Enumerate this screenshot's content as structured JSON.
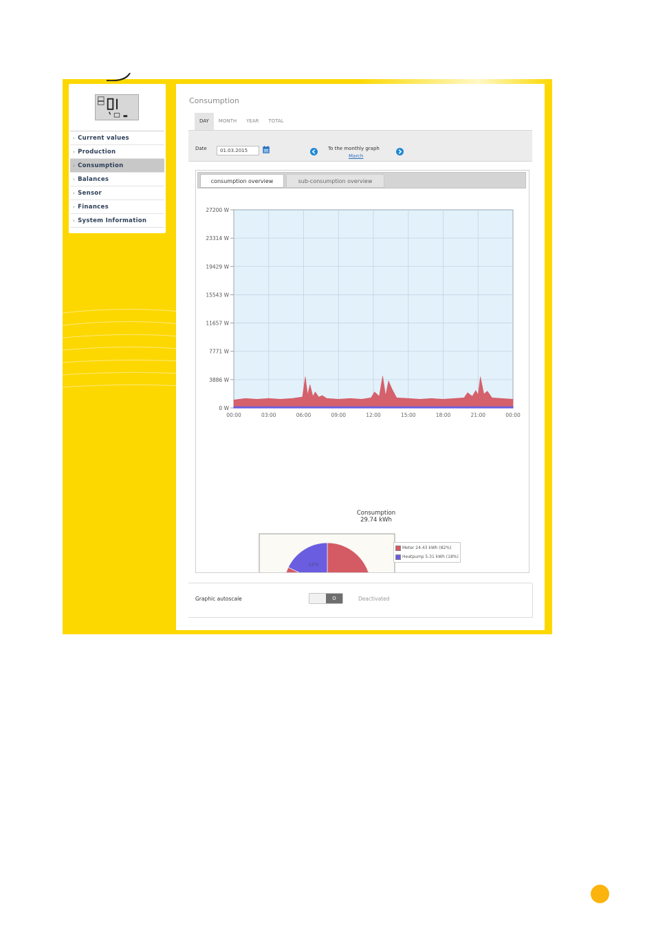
{
  "sidebar": {
    "items": [
      {
        "label": "Current values",
        "active": false
      },
      {
        "label": "Production",
        "active": false
      },
      {
        "label": "Consumption",
        "active": true
      },
      {
        "label": "Balances",
        "active": false
      },
      {
        "label": "Sensor",
        "active": false
      },
      {
        "label": "Finances",
        "active": false
      },
      {
        "label": "System Information",
        "active": false
      }
    ]
  },
  "panel": {
    "title": "Consumption",
    "tabs": [
      "DAY",
      "MONTH",
      "YEAR",
      "TOTAL"
    ],
    "active_tab": "DAY",
    "date_label": "Date",
    "date_value": "01.03.2015",
    "monthly_label": "To the monthly graph",
    "monthly_link": "March",
    "subtabs": [
      "consumption overview",
      "sub-consumption overview"
    ],
    "active_subtab": "consumption overview",
    "autoscale_label": "Graphic autoscale",
    "toggle_knob": "O",
    "toggle_status": "Deactivated"
  },
  "colors": {
    "frame_yellow": "#fcd800",
    "meter": "#d45a64",
    "heatpump": "#6a5de0",
    "plot_bg": "#e3f1fb",
    "page_dot": "#fbb40e"
  },
  "icons": [
    "calendar-icon",
    "arrow-left-icon",
    "arrow-right-icon"
  ],
  "chart_data": [
    {
      "type": "area",
      "title": "Consumption",
      "subtitle": "29.74 kWh",
      "x_ticks": [
        "00:00",
        "03:00",
        "06:00",
        "09:00",
        "12:00",
        "15:00",
        "18:00",
        "21:00",
        "00:00"
      ],
      "y_ticks": [
        "27200 W",
        "23314 W",
        "19429 W",
        "15543 W",
        "11657 W",
        "7771 W",
        "3886 W",
        "0 W"
      ],
      "ylim": [
        0,
        27200
      ],
      "grid": true,
      "series": [
        {
          "name": "Meter",
          "color": "#d45a64",
          "x_hours": [
            0,
            1,
            2,
            3,
            4,
            5,
            5.9,
            6.15,
            6.35,
            6.55,
            6.8,
            7,
            7.3,
            7.6,
            8,
            9,
            10,
            11,
            11.8,
            12.1,
            12.5,
            12.8,
            13.05,
            13.3,
            13.6,
            14,
            15,
            16,
            17,
            18,
            19,
            19.8,
            20.1,
            20.5,
            20.8,
            21,
            21.2,
            21.5,
            21.8,
            22.2,
            23,
            24
          ],
          "values": [
            1100,
            1300,
            1200,
            1300,
            1200,
            1300,
            1500,
            4300,
            1800,
            3200,
            1600,
            2200,
            1500,
            1700,
            1300,
            1200,
            1300,
            1200,
            1400,
            2200,
            1600,
            4400,
            1700,
            3700,
            2600,
            1400,
            1300,
            1200,
            1300,
            1200,
            1300,
            1400,
            2100,
            1600,
            2400,
            1800,
            4300,
            1900,
            2300,
            1400,
            1300,
            1200
          ]
        },
        {
          "name": "Heatpump",
          "color": "#6a5de0",
          "x_hours": [
            0,
            24
          ],
          "values": [
            150,
            150
          ]
        }
      ]
    },
    {
      "type": "pie",
      "labels": [
        "Meter 24.43 kWh (82%)",
        "Heatpump 5.31 kWh (18%)"
      ],
      "values": [
        24.43,
        5.31
      ],
      "slice_labels": [
        "82%",
        "18%"
      ],
      "colors": [
        "#d45a64",
        "#6a5de0"
      ],
      "legend": "right"
    }
  ]
}
